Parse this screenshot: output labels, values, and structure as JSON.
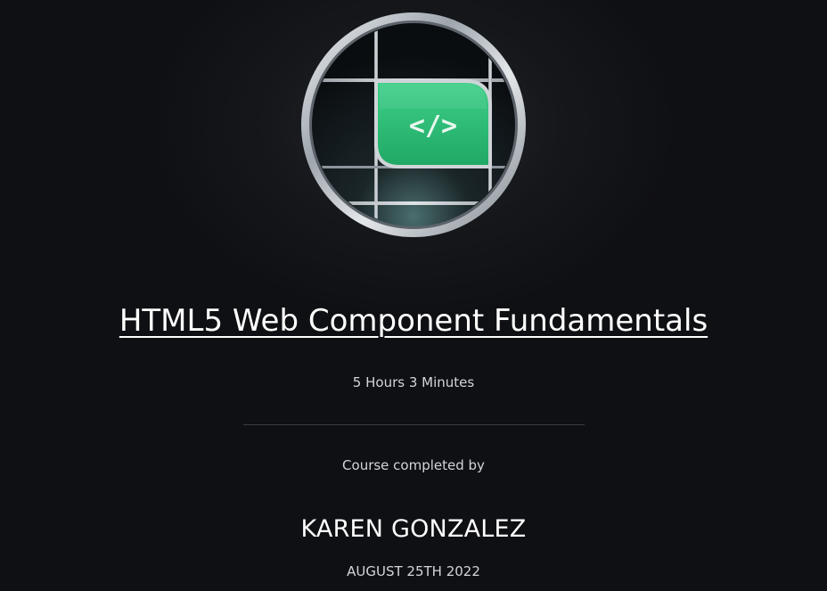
{
  "badge": {
    "icon": "code-brackets-icon",
    "symbol": "</>",
    "accent_color": "#2fc27a"
  },
  "course": {
    "title": "HTML5 Web Component Fundamentals",
    "duration": "5 Hours 3 Minutes"
  },
  "certificate": {
    "completed_by_label": "Course completed by",
    "student_name": "KAREN GONZALEZ",
    "date": "AUGUST 25TH 2022"
  }
}
